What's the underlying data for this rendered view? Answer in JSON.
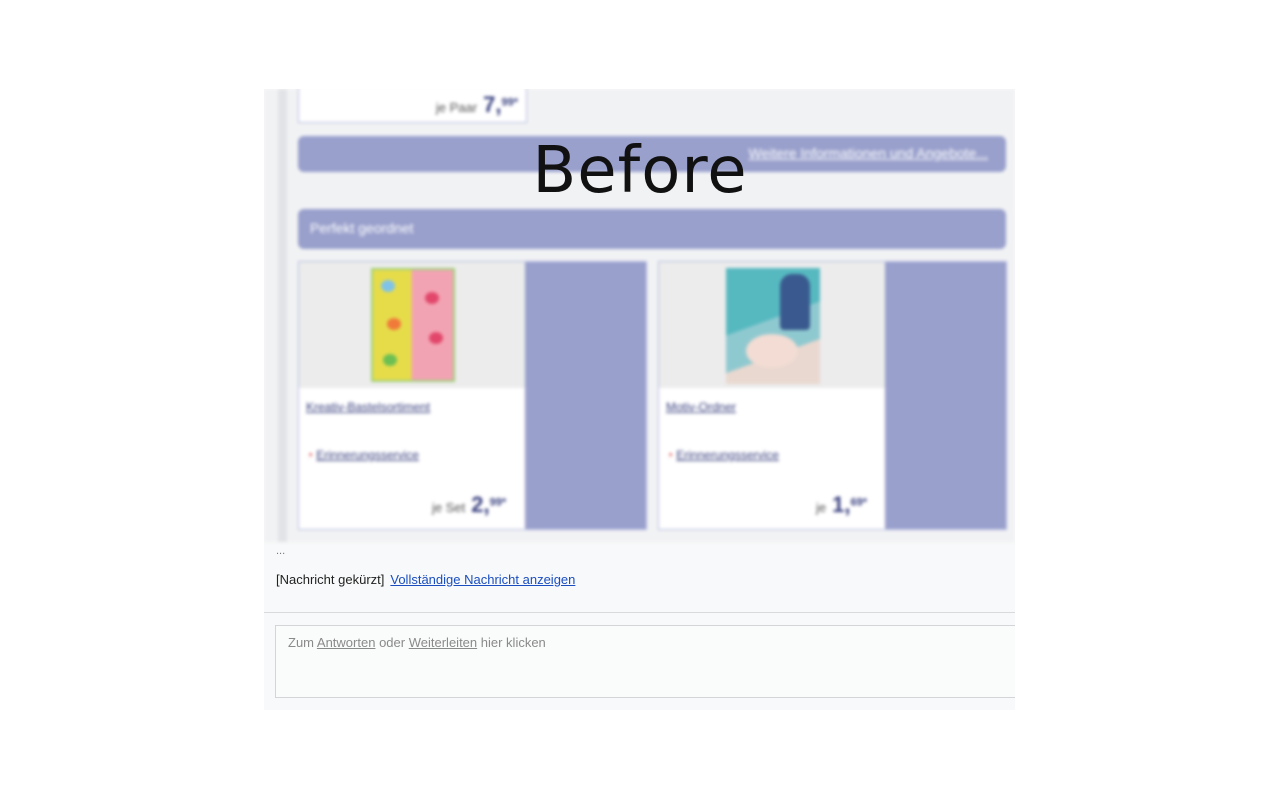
{
  "overlay": {
    "label": "Before"
  },
  "email": {
    "top_offer": {
      "unit": "je Paar",
      "price_main": "7,",
      "price_cents": "99*"
    },
    "more_info_link": "Weitere Informationen und Angebote...",
    "section_title": "Perfekt geordnet",
    "products": [
      {
        "name": "Kreativ-Bastelsortiment",
        "reminder": "Erinnerungsservice",
        "unit": "je Set",
        "price_main": "2,",
        "price_cents": "99*",
        "image_icon": "sticker-sheet"
      },
      {
        "name": "Motiv-Ordner",
        "reminder": "Erinnerungsservice",
        "unit": "je",
        "price_main": "1,",
        "price_cents": "69*",
        "image_icon": "folder"
      }
    ]
  },
  "message": {
    "ellipsis": "...",
    "truncated_label": "[Nachricht gekürzt]",
    "show_full_link": "Vollständige Nachricht anzeigen"
  },
  "reply": {
    "prefix": "Zum",
    "reply_link": "Antworten",
    "middle": "oder",
    "forward_link": "Weiterleiten",
    "suffix": "hier klicken"
  },
  "colors": {
    "brand_panel": "#99a0cc",
    "brand_text": "#39407f",
    "link": "#1a4ec0"
  }
}
